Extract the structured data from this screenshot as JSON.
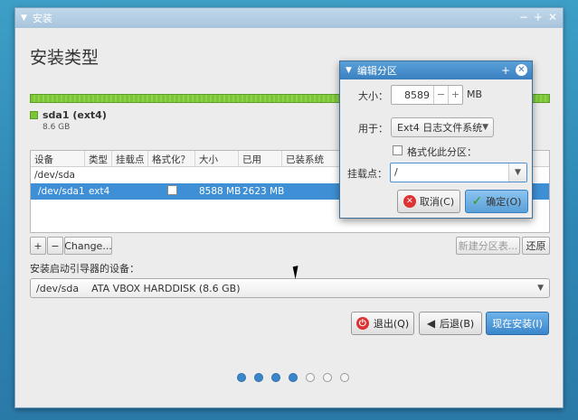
{
  "window": {
    "title": "安装"
  },
  "page": {
    "heading": "安装类型"
  },
  "disk_bar": {
    "name": "sda1 (ext4)",
    "size": "8.6 GB",
    "color": "#7cc43a"
  },
  "table": {
    "headers": [
      "设备",
      "类型",
      "挂载点",
      "格式化？",
      "大小",
      "已用",
      "已装系统"
    ],
    "rows": [
      {
        "device": "/dev/sda",
        "type": "",
        "mount": "",
        "size": "",
        "used": ""
      },
      {
        "device": "/dev/sda1",
        "type": "ext4",
        "mount": "",
        "size": "8588 MB",
        "used": "2623 MB"
      }
    ]
  },
  "partition_buttons": {
    "add": "+",
    "remove": "−",
    "change": "Change...",
    "new_table": "新建分区表...",
    "revert": "还原"
  },
  "bootloader": {
    "label": "安装启动引导器的设备：",
    "value": "/dev/sda    ATA VBOX HARDDISK (8.6 GB)"
  },
  "nav": {
    "quit": "退出(Q)",
    "back": "后退(B)",
    "install": "现在安装(I)"
  },
  "progress": {
    "total_steps": 7,
    "current_step": 4
  },
  "dialog": {
    "title": "编辑分区",
    "size_label": "大小：",
    "size_value": "8589",
    "size_unit": "MB",
    "use_label": "用于：",
    "use_value": "Ext4 日志文件系统",
    "format_label": "格式化此分区：",
    "mount_label": "挂载点：",
    "mount_value": "/",
    "cancel": "取消(C)",
    "ok": "确定(O)"
  },
  "colors": {
    "accent": "#3a86cc",
    "selection": "#3f8fd6",
    "desktop": "#2f86b4"
  }
}
